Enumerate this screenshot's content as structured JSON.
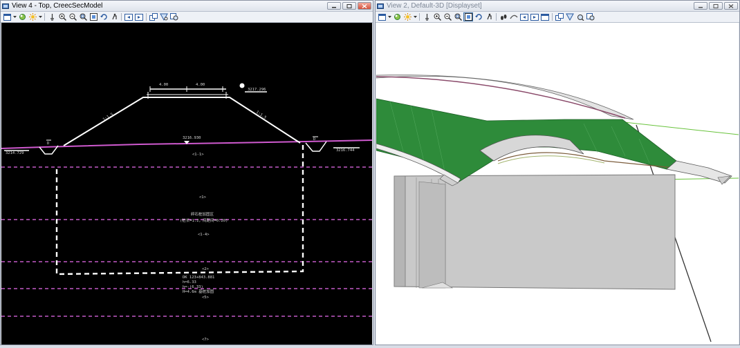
{
  "left_window": {
    "title": "View 4 - Top, CreecSecModel",
    "app_icon": "microstation-view-icon",
    "toolbar_icons": [
      "view-attributes-icon",
      "dropdown-arrow-icon",
      "view-display-style-icon",
      "lighting-icon",
      "dropdown-arrow-icon",
      "pan-view-icon",
      "zoom-in-icon",
      "zoom-out-icon",
      "window-area-icon",
      "fit-view-icon",
      "rotate-view-icon",
      "walk-icon",
      "view-previous-icon",
      "view-next-icon",
      "copy-view-icon",
      "clip-volume-icon",
      "clip-mask-icon"
    ],
    "drawing": {
      "road_dimensions": [
        "4.00",
        "4.00"
      ],
      "slope_left": "1:1.5",
      "slope_right": "1:1.5",
      "center_elevation": "3216.930",
      "elevation_left": "3214.729",
      "elevation_right": "3216.744",
      "elevation_top_right": "3217.296",
      "ditch_left_label": "D",
      "ditch_right_label": "D",
      "layer_1_1": "<1-1>",
      "layer_1": "<1>",
      "zone_name": "碎石桩加固区",
      "zone_params": "(桩长=1.2，间距间=0.20)",
      "layer_1_4": "<1-4>",
      "layer_2": "<2>",
      "pile_info_1": "DK 123+843.881",
      "pile_info_2": "h=6.33",
      "pile_info_3": "h=-(6.33)",
      "pile_info_4": "H=4.6m 基桩加固",
      "layer_5": "<5>",
      "layer_7": "<7>"
    }
  },
  "right_window": {
    "title": "View 2, Default-3D [Displayset]",
    "app_icon": "microstation-view-icon",
    "toolbar_icons": [
      "view-attributes-icon",
      "dropdown-arrow-icon",
      "view-display-style-icon",
      "lighting-icon",
      "dropdown-arrow-icon",
      "pan-view-icon",
      "zoom-in-icon",
      "zoom-out-icon",
      "window-area-icon",
      "fit-view-icon",
      "rotate-view-icon",
      "walk-icon",
      "fly-icon",
      "view-previous-icon",
      "view-next-icon",
      "camera-icon",
      "copy-view-icon",
      "clip-volume-icon",
      "clip-mask-icon",
      "clip-volume-alt-icon"
    ]
  },
  "colors": {
    "left_background": "#000000",
    "right_background": "#ffffff",
    "ground_line": "#d05ad0",
    "embankment": "#ffffff",
    "surface_green": "#2e8b3a",
    "grey_block": "#c9c9c9"
  }
}
